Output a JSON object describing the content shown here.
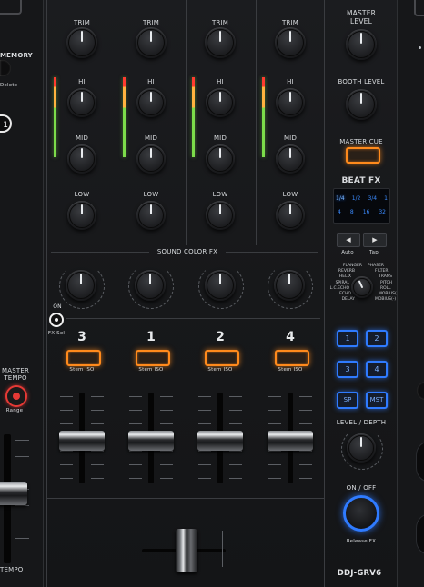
{
  "left_panel": {
    "memory_label": "MEMORY",
    "delete_label": "Delete",
    "hotcue_number": "1",
    "master_tempo_label": "MASTER\nTEMPO",
    "range_label": "Range",
    "tempo_label": "TEMPO"
  },
  "channels": [
    {
      "trim": "TRIM",
      "hi": "HI",
      "mid": "MID",
      "low": "LOW"
    },
    {
      "trim": "TRIM",
      "hi": "HI",
      "mid": "MID",
      "low": "LOW"
    },
    {
      "trim": "TRIM",
      "hi": "HI",
      "mid": "MID",
      "low": "LOW"
    },
    {
      "trim": "TRIM",
      "hi": "HI",
      "mid": "MID",
      "low": "LOW"
    }
  ],
  "sound_color_fx": {
    "label": "SOUND COLOR FX",
    "on_label": "ON",
    "fxsel_label": "FX Sel"
  },
  "fader_channels": [
    {
      "number": "3",
      "stem": "Stem ISO"
    },
    {
      "number": "1",
      "stem": "Stem ISO"
    },
    {
      "number": "2",
      "stem": "Stem ISO"
    },
    {
      "number": "4",
      "stem": "Stem ISO"
    }
  ],
  "right_panel": {
    "master_level": "MASTER\nLEVEL",
    "booth_level": "BOOTH LEVEL",
    "master_cue": "MASTER CUE",
    "beat_fx": "BEAT FX",
    "beat_display_row1": [
      "1/4",
      "1/2",
      "3/4",
      "1"
    ],
    "beat_display_row2": [
      "4",
      "8",
      "16",
      "32"
    ],
    "left_arrow": "◀",
    "right_arrow": "▶",
    "auto_label": "Auto",
    "tap_label": "Tap",
    "fx_types_left": [
      "FLANGER",
      "REVERB",
      "HELIX",
      "SPIRAL",
      "L.C.ECHO",
      "ECHO",
      "DELAY"
    ],
    "fx_types_right": [
      "PHASER",
      "FILTER",
      "TRANS",
      "PITCH",
      "ROLL",
      "MOBIUS(+)",
      "MOBIUS(-)"
    ],
    "ch_buttons": [
      "1",
      "2",
      "3",
      "4"
    ],
    "sp_label": "SP",
    "mst_label": "MST",
    "level_depth": "LEVEL / DEPTH",
    "on_off": "ON / OFF",
    "release_fx": "Release FX",
    "model": "DDJ-GRV6"
  },
  "colors": {
    "accent_orange": "#ff8a1c",
    "accent_blue": "#2f7bff",
    "accent_red": "#e53935"
  }
}
